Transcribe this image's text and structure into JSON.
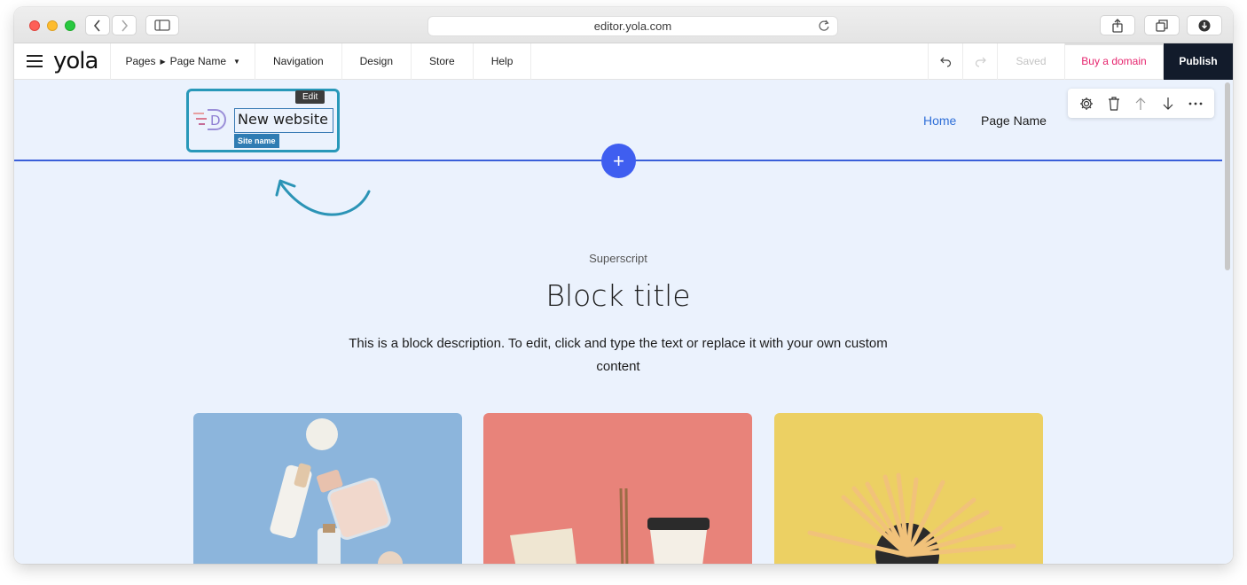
{
  "browser": {
    "url": "editor.yola.com"
  },
  "app": {
    "logo": "yola",
    "pages_label": "Pages",
    "page_name": "Page Name",
    "menu": [
      "Navigation",
      "Design",
      "Store",
      "Help"
    ],
    "saved": "Saved",
    "buy_domain": "Buy a domain",
    "publish": "Publish",
    "colors": {
      "publish_bg": "#121b2b",
      "buy_text": "#e6256e",
      "accent": "#3f5ef0"
    }
  },
  "header": {
    "edit_tag": "Edit",
    "site_name": "New website",
    "site_name_tag": "Site name",
    "nav": [
      "Home",
      "Page Name"
    ]
  },
  "block_tools": [
    "gear-icon",
    "trash-icon",
    "arrow-up-icon",
    "arrow-down-icon",
    "more-icon"
  ],
  "block": {
    "superscript": "Superscript",
    "title": "Block title",
    "description": "This is a block description. To edit, click and type the text or replace it with your own custom content"
  },
  "cards": [
    "cosmetics",
    "takeaway-food",
    "pencils"
  ]
}
